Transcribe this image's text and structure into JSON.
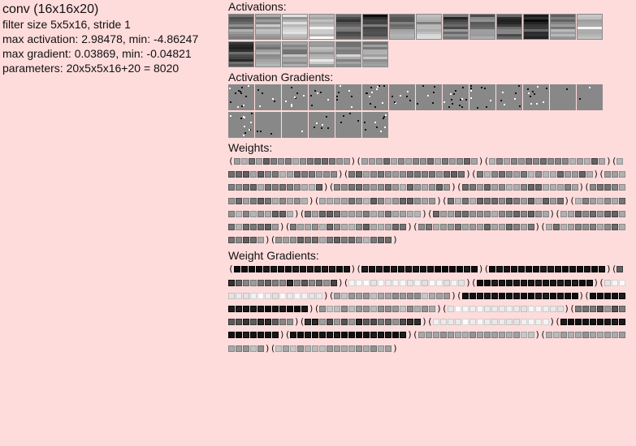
{
  "info": {
    "title": "conv (16x16x20)",
    "filter_size": "filter size 5x5x16, stride 1",
    "max_activation": "max activation: 2.98478, min: -4.86247",
    "max_gradient": "max gradient: 0.03869, min: -0.04821",
    "parameters": "parameters: 20x5x5x16+20 = 8020"
  },
  "sections": {
    "activations": "Activations:",
    "activation_gradients": "Activation Gradients:",
    "weights": "Weights:",
    "weight_gradients": "Weight Gradients:"
  },
  "counts": {
    "activation_tiles": 20,
    "gradient_tiles": 20,
    "filters": 20,
    "cells_per_filter": 16
  },
  "open_paren": "(",
  "close_paren": ")"
}
